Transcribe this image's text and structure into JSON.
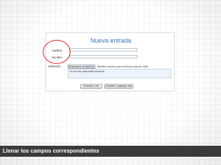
{
  "form": {
    "title": "Nueva entrada",
    "fields": {
      "apellido_label": "Apellido",
      "nombre_label": "Nombre",
      "reflexion_label": "Reflexión:"
    },
    "file_button_label": "Seleccione un archivo...",
    "size_hint": "Tamaño máximo para archivos nuevos: 5Mb",
    "attachments_empty_text": "No se han adjuntado archivos",
    "save_view_label": "Guardar y ver",
    "save_add_label": "Guardar y agregar otro"
  },
  "highlight": {
    "color": "#e02020"
  },
  "caption": {
    "text": "Llenar los campos correspondientes"
  },
  "colors": {
    "title": "#3b73b9",
    "caption_bar": "#3a3a3a",
    "attach_bg": "#edf3fa"
  }
}
